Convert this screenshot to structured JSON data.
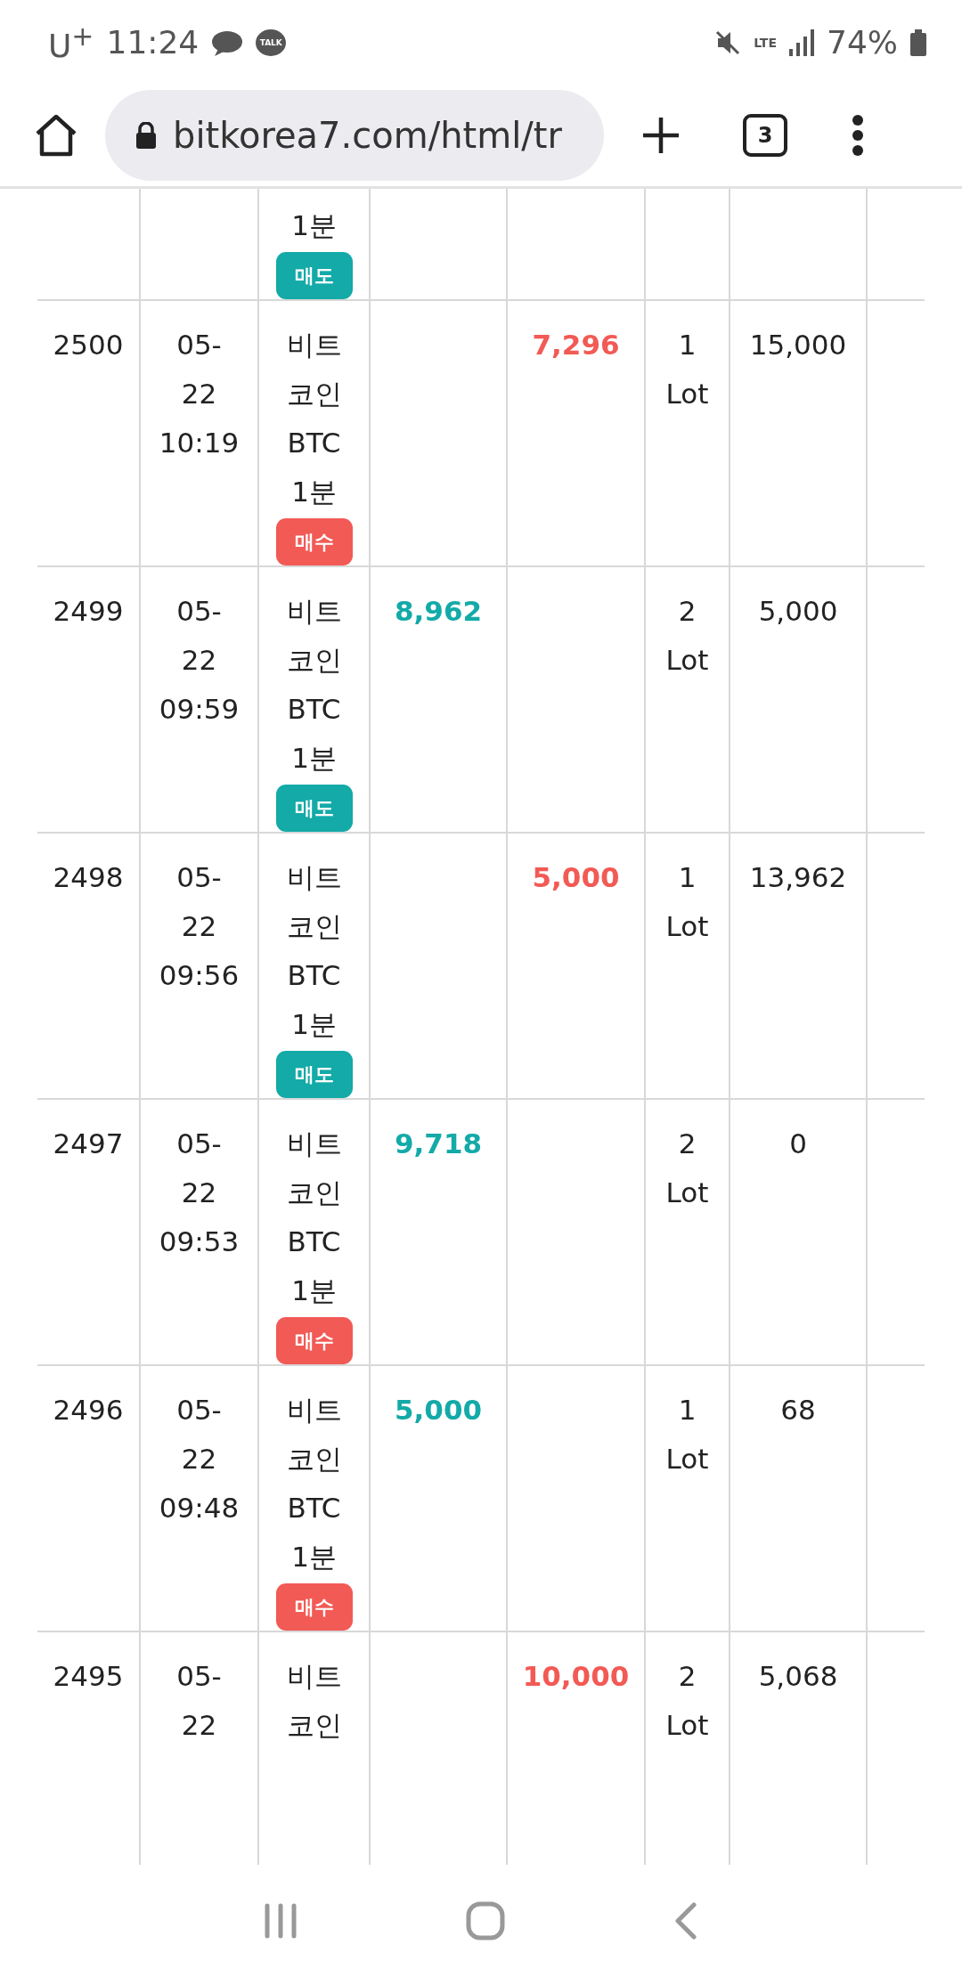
{
  "status_bar": {
    "carrier": "U$^{+}$",
    "time": "11:24",
    "talk_badge": "TALK",
    "network": "LTE",
    "battery": "74%"
  },
  "browser": {
    "url": "bitkorea7.com/html/tr",
    "tab_count": "3"
  },
  "rows": [
    {
      "product": "1분",
      "kind": "sell",
      "badge": "매도"
    },
    {
      "number": "2500",
      "date": "05-22",
      "time": "10:19",
      "product": "비트코인 BTC 1분",
      "kind": "buy",
      "badge": "매수",
      "column_5": "7,296",
      "lot": "1 Lot",
      "balance": "15,000"
    },
    {
      "number": "2499",
      "date": "05-22",
      "time": "09:59",
      "product": "비트코인 BTC 1분",
      "kind": "sell",
      "badge": "매도",
      "column_4": "8,962",
      "lot": "2 Lot",
      "balance": "5,000"
    },
    {
      "number": "2498",
      "date": "05-22",
      "time": "09:56",
      "product": "비트코인 BTC 1분",
      "kind": "sell",
      "badge": "매도",
      "column_5": "5,000",
      "lot": "1 Lot",
      "balance": "13,962"
    },
    {
      "number": "2497",
      "date": "05-22",
      "time": "09:53",
      "product": "비트코인 BTC 1분",
      "kind": "buy",
      "badge": "매수",
      "column_4": "9,718",
      "lot": "2 Lot",
      "balance": "0"
    },
    {
      "number": "2496",
      "date": "05-22",
      "time": "09:48",
      "product": "비트코인 BTC 1분",
      "kind": "buy",
      "badge": "매수",
      "column_4": "5,000",
      "lot": "1 Lot",
      "balance": "68"
    },
    {
      "number": "2495",
      "date": "05-22",
      "product": "비트코인",
      "column_5": "10,000",
      "lot": "2 Lot",
      "balance": "5,068"
    }
  ]
}
